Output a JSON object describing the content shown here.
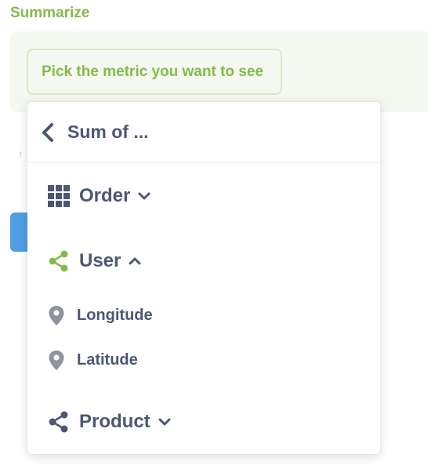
{
  "section": {
    "title": "Summarize"
  },
  "summarize": {
    "placeholder": "Pick the metric you want to see"
  },
  "background": {
    "sort_hint": "↑"
  },
  "popover": {
    "title": "Sum of ...",
    "groups": [
      {
        "label": "Order",
        "icon": "table-grid-icon",
        "expanded": false
      },
      {
        "label": "User",
        "icon": "connections-icon",
        "expanded": true
      },
      {
        "label": "Product",
        "icon": "connections-icon",
        "expanded": false
      }
    ],
    "fields": [
      {
        "label": "Longitude",
        "icon": "location-pin-icon"
      },
      {
        "label": "Latitude",
        "icon": "location-pin-icon"
      }
    ]
  },
  "colors": {
    "brand_green": "#84bb4c",
    "text_dark": "#4c5773",
    "icon_gray": "#8e93a0",
    "brand_blue": "#509ee3"
  }
}
